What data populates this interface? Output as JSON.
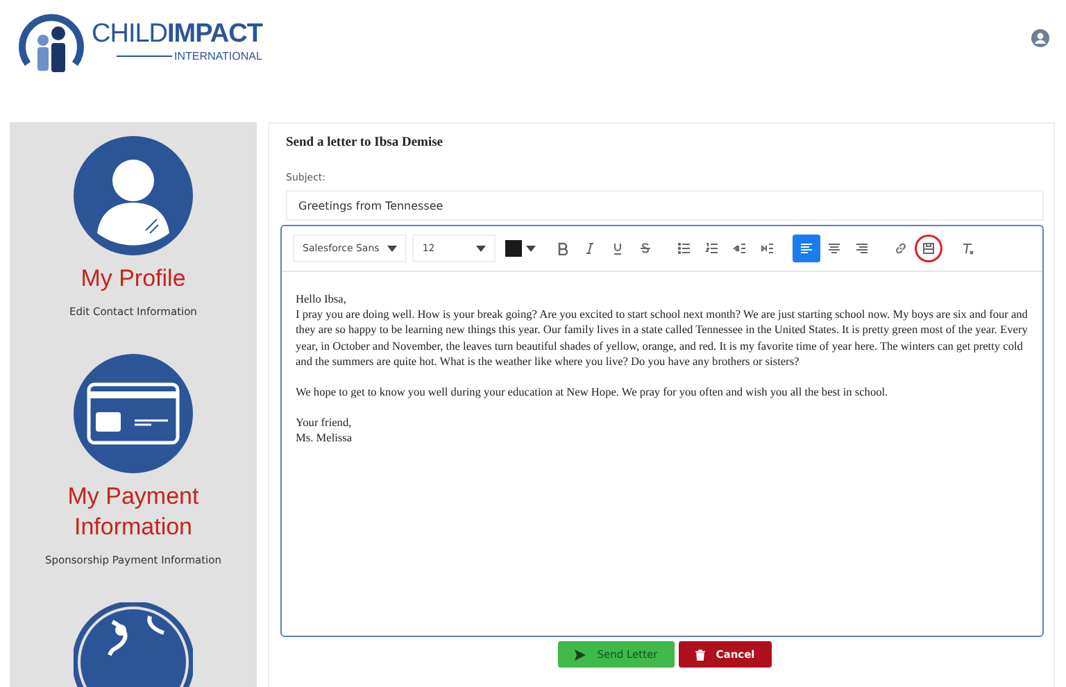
{
  "logo": {
    "name_light": "CHILD",
    "name_bold": "IMPACT",
    "tagline": "INTERNATIONAL"
  },
  "sidebar": {
    "items": [
      {
        "kind": "profile",
        "title": "My Profile",
        "subtitle": "Edit Contact Information"
      },
      {
        "kind": "payment",
        "title": "My Payment Information",
        "subtitle": "Sponsorship Payment Information"
      },
      {
        "kind": "globe"
      }
    ]
  },
  "letter_form": {
    "heading": "Send a letter to Ibsa Demise",
    "subject_label": "Subject:",
    "subject_value": "Greetings from Tennessee",
    "toolbar": [
      {
        "kind": "select",
        "value": "Salesforce Sans"
      },
      {
        "kind": "select",
        "value": "12"
      },
      {
        "kind": "color",
        "color": "#1a1a1a"
      },
      {
        "kind": "group",
        "buttons": [
          {
            "selected": false,
            "circled": false
          },
          {
            "selected": false,
            "circled": false
          },
          {
            "selected": false,
            "circled": false
          },
          {
            "selected": false,
            "circled": false
          }
        ]
      },
      {
        "kind": "group",
        "buttons": [
          {
            "selected": false,
            "circled": false
          },
          {
            "selected": false,
            "circled": false
          },
          {
            "selected": false,
            "circled": false
          },
          {
            "selected": false,
            "circled": false
          }
        ]
      },
      {
        "kind": "group",
        "buttons": [
          {
            "selected": true,
            "circled": false
          },
          {
            "selected": false,
            "circled": false
          },
          {
            "selected": false,
            "circled": false
          }
        ]
      },
      {
        "kind": "group",
        "buttons": [
          {
            "selected": false,
            "circled": false
          },
          {
            "selected": false,
            "circled": true
          }
        ]
      },
      {
        "kind": "group",
        "buttons": [
          {
            "selected": false,
            "circled": false
          }
        ]
      }
    ],
    "body": [
      [
        "Hello Ibsa,",
        "I pray you are doing well. How is your break going? Are you excited to start school next month? We are just starting school now. My boys are six and four and they are so happy to be learning new things this year. Our family lives in a state called Tennessee in the United States. It is pretty green most of the year. Every year, in October and November, the leaves turn beautiful shades of yellow, orange, and red. It is my favorite time of year here. The winters can get pretty cold and the summers are quite hot. What is the weather like where you live? Do you have any brothers or sisters?"
      ],
      [
        "We hope to get to know you well during your education at New Hope. We pray for you often and wish you all the best in school."
      ],
      [
        "Your friend,",
        "Ms. Melissa"
      ]
    ],
    "buttons": [
      {
        "kind": "send",
        "label": "Send Letter"
      },
      {
        "kind": "cancel",
        "label": "Cancel"
      }
    ]
  }
}
